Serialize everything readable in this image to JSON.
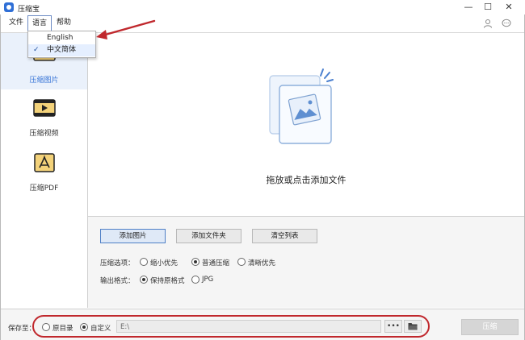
{
  "app": {
    "title": "压缩宝"
  },
  "window": {
    "minimize": "—",
    "maximize": "☐",
    "close": "✕"
  },
  "menu": {
    "file": "文件",
    "language": "语言",
    "help": "帮助"
  },
  "language_dropdown": {
    "items": [
      {
        "label": "English",
        "checked": false
      },
      {
        "label": "中文简体",
        "checked": true
      }
    ],
    "check_mark": "✓"
  },
  "sidebar": {
    "items": [
      {
        "label": "压缩图片",
        "active": true
      },
      {
        "label": "压缩视频",
        "active": false
      },
      {
        "label": "压缩PDF",
        "active": false
      }
    ]
  },
  "drop_area": {
    "text": "拖放或点击添加文件"
  },
  "actions": {
    "add_image": "添加图片",
    "add_folder": "添加文件夹",
    "clear_list": "清空列表"
  },
  "compress_options": {
    "label": "压缩选项：",
    "options": [
      {
        "label": "缩小优先",
        "selected": false
      },
      {
        "label": "普通压缩",
        "selected": true
      },
      {
        "label": "清晰优先",
        "selected": false
      }
    ]
  },
  "output_format": {
    "label": "输出格式：",
    "options": [
      {
        "label": "保持原格式",
        "selected": true
      },
      {
        "label": "JPG",
        "selected": false
      }
    ]
  },
  "save_to": {
    "label": "保存至：",
    "options": [
      {
        "label": "原目录",
        "selected": false
      },
      {
        "label": "自定义",
        "selected": true
      }
    ],
    "path": "E:\\",
    "browse_label": "•••",
    "compress_button": "压缩"
  },
  "colors": {
    "accent": "#3875d7",
    "annotation": "#c0282d"
  }
}
